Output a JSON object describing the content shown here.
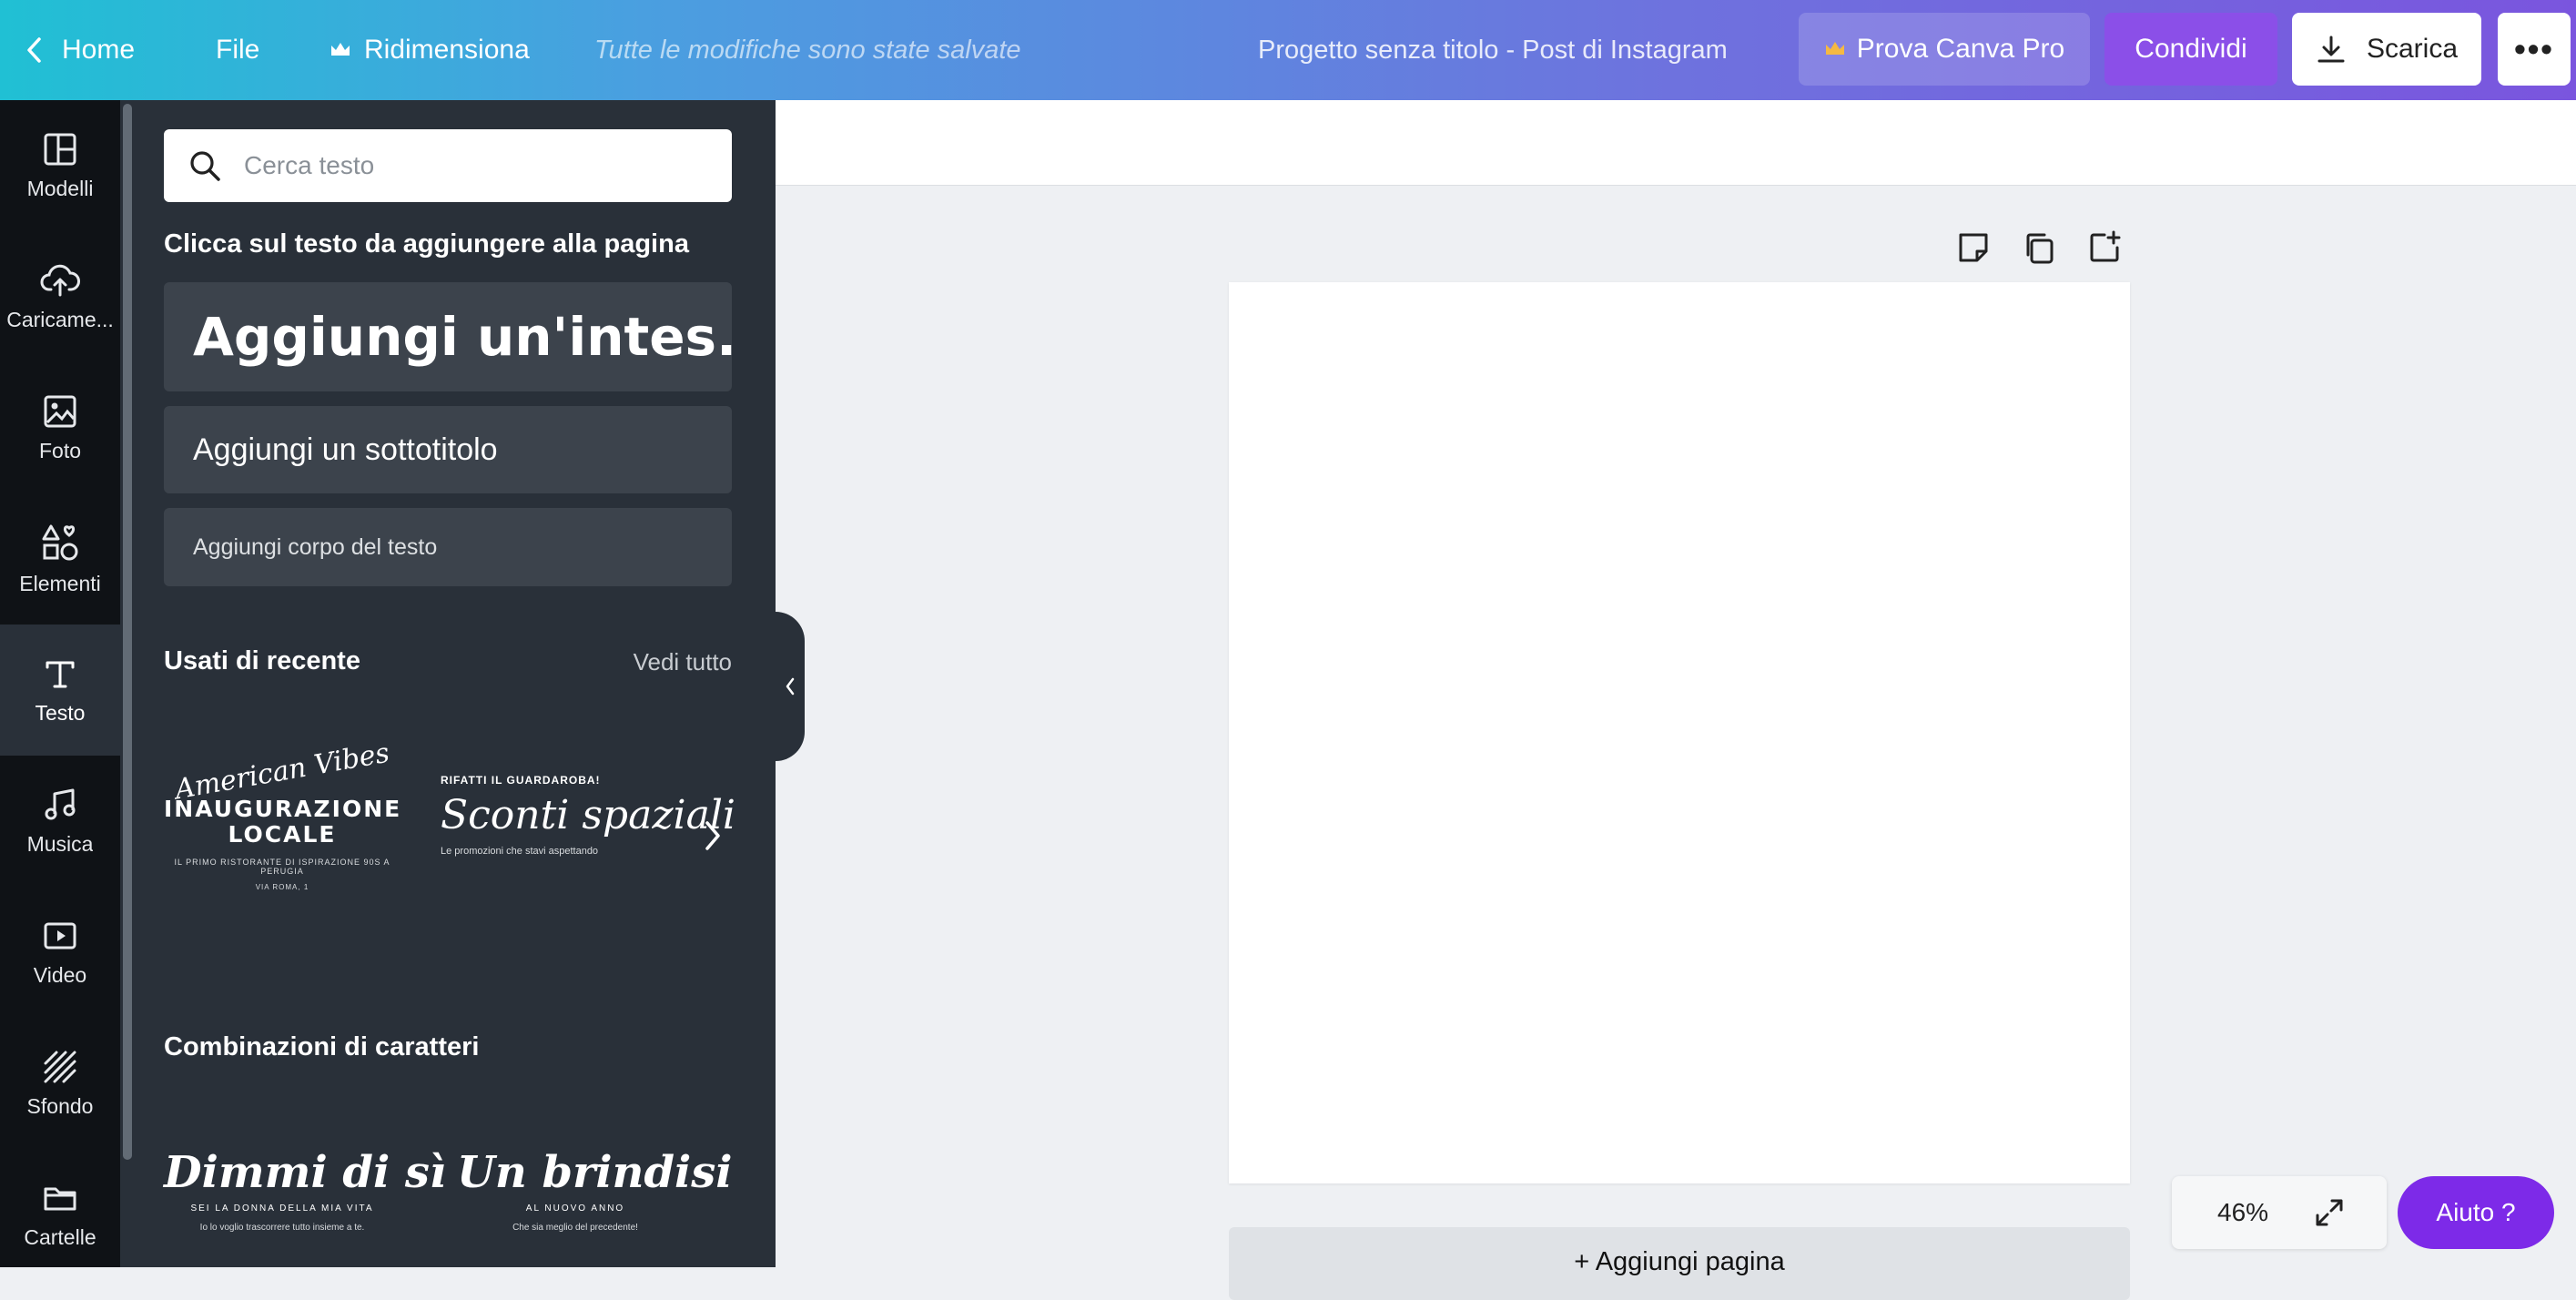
{
  "topbar": {
    "home": "Home",
    "file": "File",
    "resize": "Ridimensiona",
    "save_status": "Tutte le modifiche sono state salvate",
    "doc_title": "Progetto senza titolo - Post di Instagram",
    "pro_button": "Prova Canva Pro",
    "share_button": "Condividi",
    "download_button": "Scarica",
    "more_button": "•••"
  },
  "rail": {
    "items": [
      {
        "label": "Modelli",
        "icon": "layout-icon"
      },
      {
        "label": "Caricame...",
        "icon": "cloud-upload-icon"
      },
      {
        "label": "Foto",
        "icon": "image-icon"
      },
      {
        "label": "Elementi",
        "icon": "shapes-icon"
      },
      {
        "label": "Testo",
        "icon": "text-icon",
        "active": true
      },
      {
        "label": "Musica",
        "icon": "music-icon"
      },
      {
        "label": "Video",
        "icon": "video-icon"
      },
      {
        "label": "Sfondo",
        "icon": "background-icon"
      },
      {
        "label": "Cartelle",
        "icon": "folder-icon"
      }
    ]
  },
  "panel": {
    "search_placeholder": "Cerca testo",
    "hint": "Clicca sul testo da aggiungere alla pagina",
    "add_heading": "Aggiungi un'intes...",
    "add_subtitle": "Aggiungi un sottotitolo",
    "add_body": "Aggiungi corpo del testo",
    "recent_title": "Usati di recente",
    "see_all": "Vedi tutto",
    "recent": [
      {
        "script": "American Vibes",
        "main_line1": "INAUGURAZIONE",
        "main_line2": "LOCALE",
        "small": "IL PRIMO RISTORANTE DI ISPIRAZIONE 90S A PERUGIA",
        "small2": "VIA ROMA, 1"
      },
      {
        "top": "RIFATTI IL GUARDAROBA!",
        "script": "Sconti spaziali",
        "small": "Le promozioni che stavi aspettando"
      }
    ],
    "combos_title": "Combinazioni di caratteri",
    "combos": [
      {
        "script": "Dimmi di sì",
        "small": "SEI LA DONNA DELLA MIA VITA",
        "small2": "Io lo voglio trascorrere tutto insieme a te."
      },
      {
        "script": "Un brindisi",
        "small": "AL NUOVO ANNO",
        "small2": "Che sia meglio del precedente!"
      }
    ]
  },
  "canvas": {
    "add_page": "+ Aggiungi pagina",
    "zoom": "46%",
    "help": "Aiuto  ?"
  },
  "colors": {
    "panel_bg": "#293039",
    "rail_bg": "#0f1216",
    "accent_purple": "#7d2ae8",
    "share_purple": "#8b4fe8",
    "crown": "#f5b942"
  }
}
